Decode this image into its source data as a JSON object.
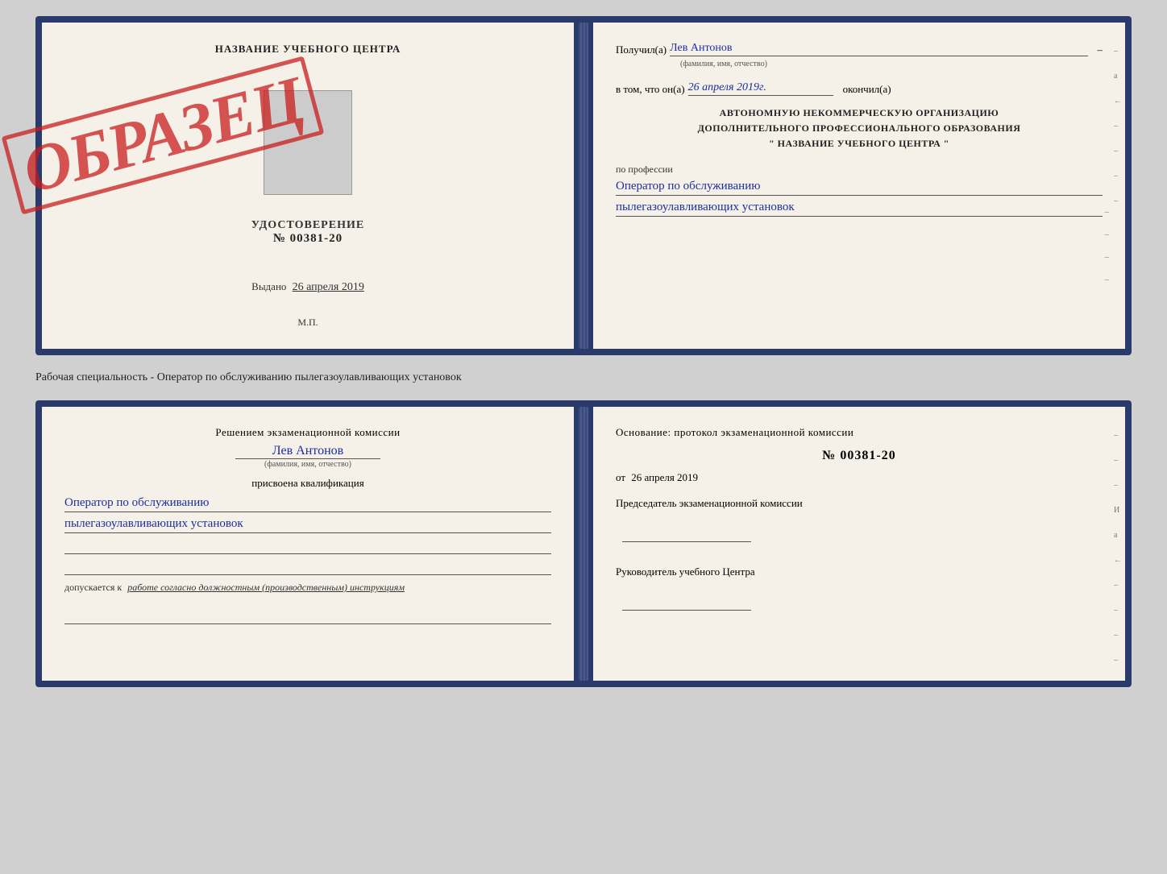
{
  "doc": {
    "title": "НАЗВАНИЕ УЧЕБНОГО ЦЕНТРА",
    "udostoverenie_label": "УДОСТОВЕРЕНИЕ",
    "number": "№ 00381-20",
    "vydano_label": "Выдано",
    "vydano_date": "26 апреля 2019",
    "mp_label": "М.П.",
    "stamp": "ОБРАЗЕЦ",
    "right1": {
      "poluchil_label": "Получил(а)",
      "poluchil_value": "Лев Антонов",
      "fio_sub": "(фамилия, имя, отчество)",
      "vtom_label": "в том, что он(а)",
      "vtom_date": "26 апреля 2019г.",
      "okoncil_label": "окончил(а)",
      "org_line1": "АВТОНОМНУЮ НЕКОММЕРЧЕСКУЮ ОРГАНИЗАЦИЮ",
      "org_line2": "ДОПОЛНИТЕЛЬНОГО ПРОФЕССИОНАЛЬНОГО ОБРАЗОВАНИЯ",
      "org_line3": "\"  НАЗВАНИЕ УЧЕБНОГО ЦЕНТРА  \"",
      "po_professii_label": "по профессии",
      "profession_1": "Оператор по обслуживанию",
      "profession_2": "пылегазоулавливающих установок"
    },
    "middle_label": "Рабочая специальность - Оператор по обслуживанию пылегазоулавливающих установок",
    "left2": {
      "decision_text": "Решением экзаменационной комиссии",
      "person_name": "Лев Антонов",
      "fio_sub": "(фамилия, имя, отчество)",
      "prisvoena_label": "присвоена квалификация",
      "qual_1": "Оператор по обслуживанию",
      "qual_2": "пылегазоулавливающих установок",
      "dopuskaetsya_label": "допускается к",
      "dopuskaetsya_value": "работе согласно должностным (производственным) инструкциям"
    },
    "right2": {
      "osnov_label": "Основание: протокол экзаменационной комиссии",
      "protocol_number": "№ 00381-20",
      "ot_label": "от",
      "ot_date": "26 апреля 2019",
      "predsedatel_label": "Председатель экзаменационной комиссии",
      "rukovoditel_label": "Руководитель учебного Центра"
    },
    "side_marks": [
      "–",
      "а",
      "←",
      "–",
      "–",
      "–",
      "–"
    ]
  }
}
